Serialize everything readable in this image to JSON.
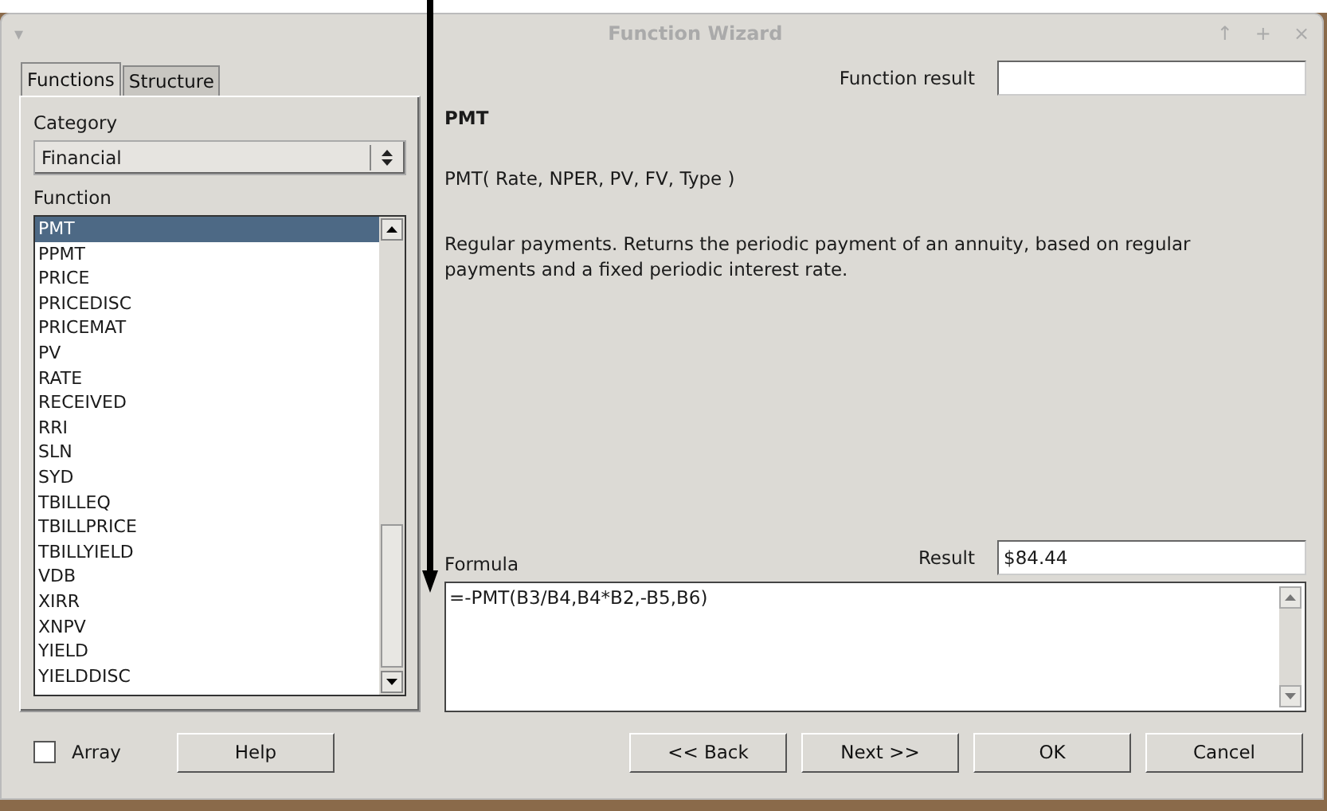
{
  "window": {
    "menu_glyph": "▾",
    "title": "Function Wizard",
    "controls": [
      "↑",
      "+",
      "×"
    ]
  },
  "tabs": [
    {
      "label": "Functions",
      "selected": true
    },
    {
      "label": "Structure",
      "selected": false
    }
  ],
  "category": {
    "label": "Category",
    "value": "Financial"
  },
  "function_list": {
    "label": "Function",
    "items": [
      {
        "name": "PMT",
        "selected": true
      },
      {
        "name": "PPMT",
        "selected": false
      },
      {
        "name": "PRICE",
        "selected": false
      },
      {
        "name": "PRICEDISC",
        "selected": false
      },
      {
        "name": "PRICEMAT",
        "selected": false
      },
      {
        "name": "PV",
        "selected": false
      },
      {
        "name": "RATE",
        "selected": false
      },
      {
        "name": "RECEIVED",
        "selected": false
      },
      {
        "name": "RRI",
        "selected": false
      },
      {
        "name": "SLN",
        "selected": false
      },
      {
        "name": "SYD",
        "selected": false
      },
      {
        "name": "TBILLEQ",
        "selected": false
      },
      {
        "name": "TBILLPRICE",
        "selected": false
      },
      {
        "name": "TBILLYIELD",
        "selected": false
      },
      {
        "name": "VDB",
        "selected": false
      },
      {
        "name": "XIRR",
        "selected": false
      },
      {
        "name": "XNPV",
        "selected": false
      },
      {
        "name": "YIELD",
        "selected": false
      },
      {
        "name": "YIELDDISC",
        "selected": false
      }
    ]
  },
  "function_result": {
    "label": "Function result"
  },
  "info": {
    "name": "PMT",
    "syntax": "PMT( Rate, NPER, PV, FV, Type )",
    "description": "Regular payments. Returns the periodic payment of an annuity, based on regular payments and a fixed periodic interest rate."
  },
  "formula": {
    "label": "Formula",
    "value": "=-PMT(B3/B4,B4*B2,-B5,B6)"
  },
  "result": {
    "label": "Result",
    "value": "$84.44"
  },
  "array": {
    "label": "Array",
    "checked": false
  },
  "buttons": {
    "help": "Help",
    "back": "<< Back",
    "next": "Next >>",
    "ok": "OK",
    "cancel": "Cancel"
  }
}
